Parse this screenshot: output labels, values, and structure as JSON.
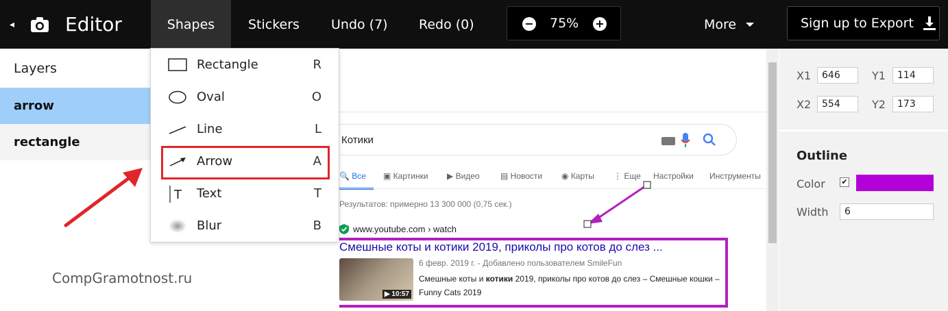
{
  "topbar": {
    "back_label": "◂",
    "title": "Editor",
    "tabs": {
      "shapes": "Shapes",
      "stickers": "Stickers",
      "undo": "Undo (7)",
      "redo": "Redo (0)"
    },
    "zoom": {
      "minus": "−",
      "value": "75%",
      "plus": "+"
    },
    "more": "More",
    "export": "Sign up to Export"
  },
  "layers": {
    "title": "Layers",
    "items": [
      {
        "label": "arrow",
        "selected": true
      },
      {
        "label": "rectangle",
        "selected": false
      }
    ]
  },
  "shapes_menu": {
    "items": [
      {
        "label": "Rectangle",
        "key": "R",
        "icon": "rectangle-icon"
      },
      {
        "label": "Oval",
        "key": "O",
        "icon": "oval-icon"
      },
      {
        "label": "Line",
        "key": "L",
        "icon": "line-icon"
      },
      {
        "label": "Arrow",
        "key": "A",
        "icon": "arrow-icon"
      },
      {
        "label": "Text",
        "key": "T",
        "icon": "text-icon"
      },
      {
        "label": "Blur",
        "key": "B",
        "icon": "blur-icon"
      }
    ]
  },
  "watermark": "CompGramotnost.ru",
  "canvas": {
    "search_query": "Котики",
    "tabs": [
      "Все",
      "Картинки",
      "Видео",
      "Новости",
      "Карты",
      "Еще",
      "Настройки",
      "Инструменты"
    ],
    "results_count": "Результатов: примерно 13 300 000 (0,75 сек.)",
    "url": "www.youtube.com › watch",
    "result_title": "Смешные коты и котики 2019, приколы про котов до слез ...",
    "meta": "6 февр. 2019 г. - Добавлено пользователем SmileFun",
    "snippet_pre": "Смешные коты и ",
    "snippet_bold": "котики",
    "snippet_post": " 2019, приколы про котов до слез – Смешные кошки – Funny Cats 2019",
    "duration": "▶ 10:57"
  },
  "properties": {
    "x1_label": "X1",
    "x1": "646",
    "y1_label": "Y1",
    "y1": "114",
    "x2_label": "X2",
    "x2": "554",
    "y2_label": "Y2",
    "y2": "173",
    "outline_title": "Outline",
    "color_label": "Color",
    "color_checked": "✔",
    "color_value": "#b400d8",
    "width_label": "Width",
    "width_value": "6"
  },
  "colors": {
    "annotation_red": "#e0262b",
    "annotation_purple": "#b21fbf",
    "selected_layer": "#9fcefb"
  }
}
